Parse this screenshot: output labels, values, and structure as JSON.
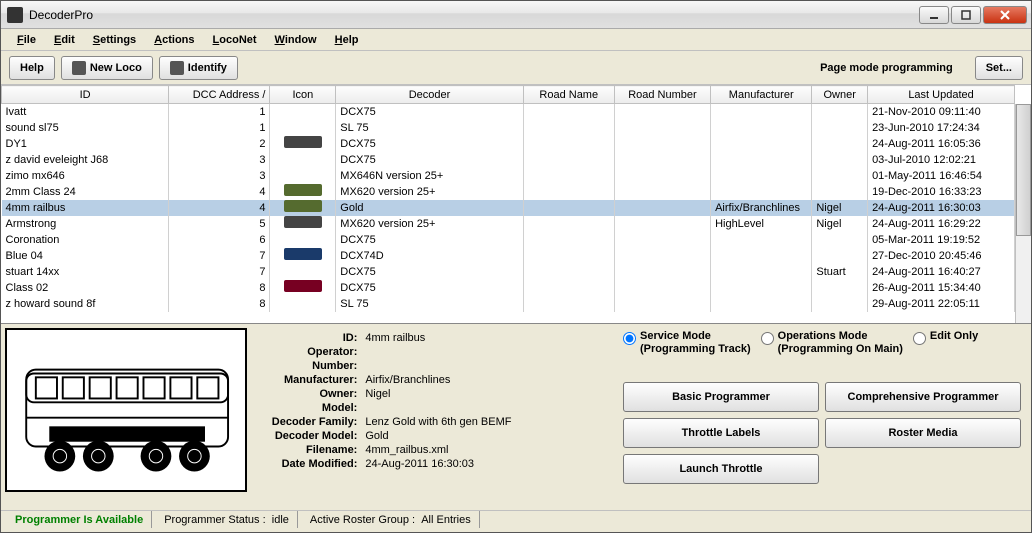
{
  "window": {
    "title": "DecoderPro"
  },
  "menu": [
    "File",
    "Edit",
    "Settings",
    "Actions",
    "LocoNet",
    "Window",
    "Help"
  ],
  "toolbar": {
    "help": "Help",
    "newLoco": "New Loco",
    "identify": "Identify",
    "modeLabel": "Page mode programming",
    "setBtn": "Set..."
  },
  "table": {
    "headers": {
      "id": "ID",
      "dcc": "DCC Address /",
      "icon": "Icon",
      "decoder": "Decoder",
      "roadName": "Road Name",
      "roadNumber": "Road Number",
      "mfr": "Manufacturer",
      "owner": "Owner",
      "updated": "Last Updated"
    },
    "rows": [
      {
        "id": "Ivatt",
        "dcc": "1",
        "icon": "",
        "decoder": "DCX75",
        "road": "",
        "rnum": "",
        "mfr": "",
        "owner": "",
        "upd": "21-Nov-2010 09:11:40"
      },
      {
        "id": "sound sl75",
        "dcc": "1",
        "icon": "",
        "decoder": "SL 75",
        "road": "",
        "rnum": "",
        "mfr": "",
        "owner": "",
        "upd": "23-Jun-2010 17:24:34"
      },
      {
        "id": "DY1",
        "dcc": "2",
        "icon": "grey",
        "decoder": "DCX75",
        "road": "",
        "rnum": "",
        "mfr": "",
        "owner": "",
        "upd": "24-Aug-2011 16:05:36"
      },
      {
        "id": "z david eveleight J68",
        "dcc": "3",
        "icon": "",
        "decoder": "DCX75",
        "road": "",
        "rnum": "",
        "mfr": "",
        "owner": "",
        "upd": "03-Jul-2010 12:02:21"
      },
      {
        "id": "zimo mx646",
        "dcc": "3",
        "icon": "",
        "decoder": "MX646N version 25+",
        "road": "",
        "rnum": "",
        "mfr": "",
        "owner": "",
        "upd": "01-May-2011 16:46:54"
      },
      {
        "id": "2mm Class 24",
        "dcc": "4",
        "icon": "green",
        "decoder": "MX620 version 25+",
        "road": "",
        "rnum": "",
        "mfr": "",
        "owner": "",
        "upd": "19-Dec-2010 16:33:23"
      },
      {
        "id": "4mm railbus",
        "dcc": "4",
        "icon": "green",
        "decoder": "Gold",
        "road": "",
        "rnum": "",
        "mfr": "Airfix/Branchlines",
        "owner": "Nigel",
        "upd": "24-Aug-2011 16:30:03",
        "selected": true
      },
      {
        "id": "Armstrong",
        "dcc": "5",
        "icon": "grey",
        "decoder": "MX620 version 25+",
        "road": "",
        "rnum": "",
        "mfr": "HighLevel",
        "owner": "Nigel",
        "upd": "24-Aug-2011 16:29:22"
      },
      {
        "id": "Coronation",
        "dcc": "6",
        "icon": "",
        "decoder": "DCX75",
        "road": "",
        "rnum": "",
        "mfr": "",
        "owner": "",
        "upd": "05-Mar-2011 19:19:52"
      },
      {
        "id": "Blue 04",
        "dcc": "7",
        "icon": "blue",
        "decoder": "DCX74D",
        "road": "",
        "rnum": "",
        "mfr": "",
        "owner": "",
        "upd": "27-Dec-2010 20:45:46"
      },
      {
        "id": "stuart 14xx",
        "dcc": "7",
        "icon": "",
        "decoder": "DCX75",
        "road": "",
        "rnum": "",
        "mfr": "",
        "owner": "Stuart",
        "upd": "24-Aug-2011 16:40:27"
      },
      {
        "id": "Class 02",
        "dcc": "8",
        "icon": "red",
        "decoder": "DCX75",
        "road": "",
        "rnum": "",
        "mfr": "",
        "owner": "",
        "upd": "26-Aug-2011 15:34:40"
      },
      {
        "id": "z howard sound 8f",
        "dcc": "8",
        "icon": "",
        "decoder": "SL 75",
        "road": "",
        "rnum": "",
        "mfr": "",
        "owner": "",
        "upd": "29-Aug-2011 22:05:11"
      }
    ]
  },
  "details": {
    "id_lbl": "ID:",
    "id_val": "4mm railbus",
    "operator_lbl": "Operator:",
    "operator_val": "",
    "number_lbl": "Number:",
    "number_val": "",
    "mfr_lbl": "Manufacturer:",
    "mfr_val": "Airfix/Branchlines",
    "owner_lbl": "Owner:",
    "owner_val": "Nigel",
    "model_lbl": "Model:",
    "model_val": "",
    "family_lbl": "Decoder Family:",
    "family_val": "Lenz Gold with 6th gen BEMF",
    "dmodel_lbl": "Decoder Model:",
    "dmodel_val": "Gold",
    "filename_lbl": "Filename:",
    "filename_val": "4mm_railbus.xml",
    "modified_lbl": "Date Modified:",
    "modified_val": "24-Aug-2011 16:30:03"
  },
  "radios": {
    "service": "Service Mode",
    "service_sub": "(Programming Track)",
    "ops": "Operations Mode",
    "ops_sub": "(Programming On Main)",
    "edit": "Edit Only"
  },
  "buttons": {
    "basic": "Basic Programmer",
    "comp": "Comprehensive Programmer",
    "throttle": "Throttle Labels",
    "roster": "Roster Media",
    "launch": "Launch Throttle"
  },
  "status": {
    "avail": "Programmer Is Available",
    "progStatusLbl": "Programmer Status :",
    "progStatusVal": "idle",
    "rosterLbl": "Active Roster Group :",
    "rosterVal": "All Entries"
  }
}
